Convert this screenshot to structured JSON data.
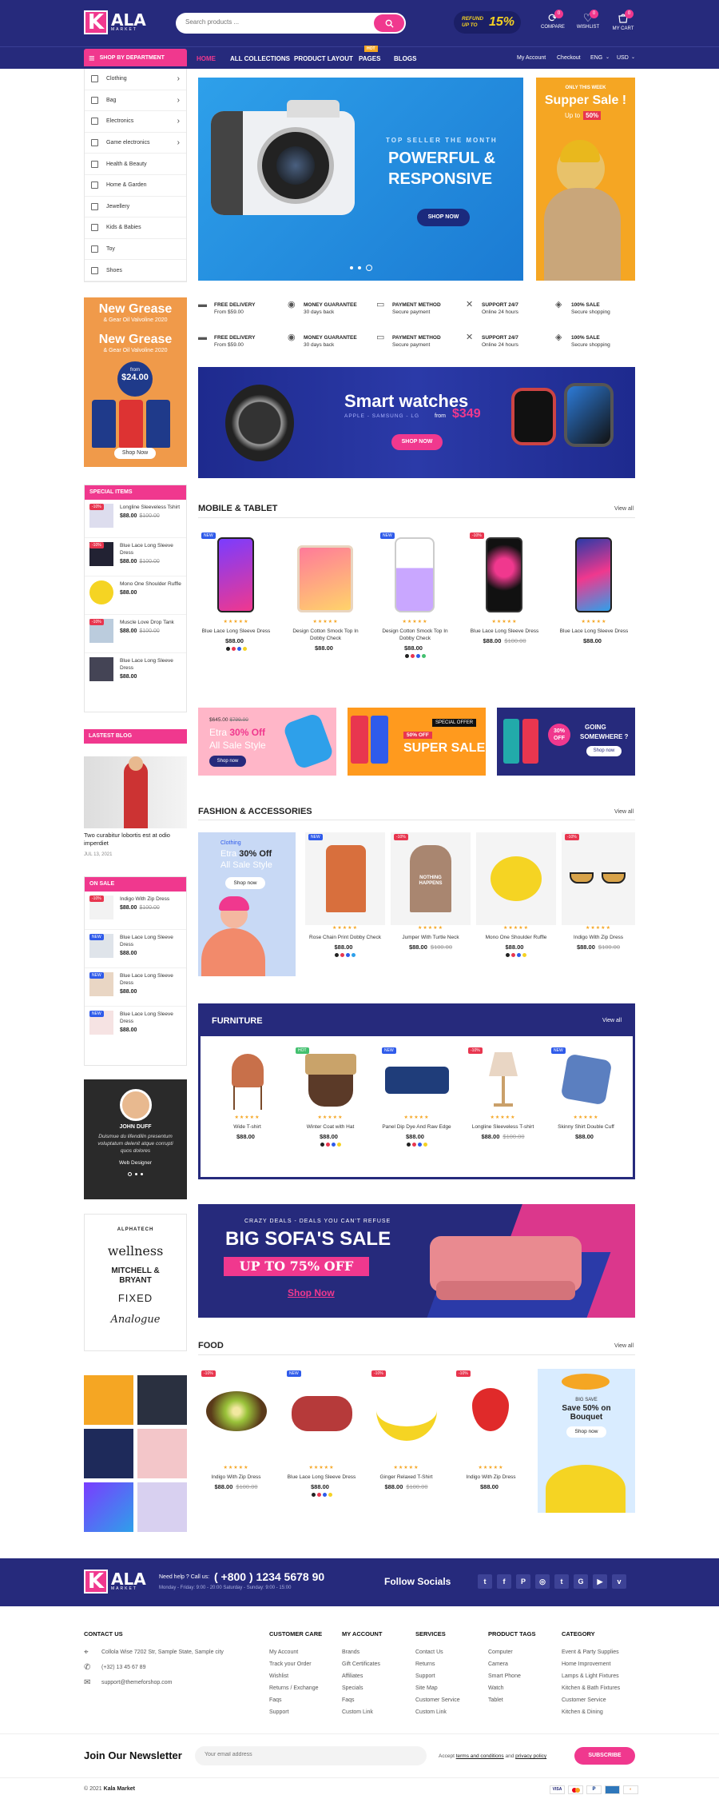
{
  "header": {
    "logo": "K",
    "logo_word": "ALA",
    "logo_sub": "MARKET",
    "search_placeholder": "Search products ...",
    "refund_line1": "REFUND",
    "refund_line2": "UP TO",
    "refund_pct": "15%",
    "compare_label": "COMPARE",
    "compare_count": "0",
    "wishlist_label": "WISHLIST",
    "wishlist_count": "0",
    "cart_label": "MY CART",
    "cart_count": "0"
  },
  "nav": {
    "shop_by": "SHOP BY DEPARTMENT",
    "items": [
      "HOME",
      "ALL COLLECTIONS",
      "PRODUCT LAYOUT",
      "PAGES",
      "BLOGS"
    ],
    "hot": "HOT",
    "right": [
      "My Account",
      "Checkout",
      "ENG",
      "USD"
    ]
  },
  "categories": [
    "Clothing",
    "Bag",
    "Electronics",
    "Game electronics",
    "Health & Beauty",
    "Home & Garden",
    "Jewellery",
    "Kids & Babies",
    "Toy",
    "Shoes"
  ],
  "hero": {
    "kicker": "TOP SELLER THE MONTH",
    "title1": "POWERFUL &",
    "title2": "RESPONSIVE",
    "cta": "SHOP NOW"
  },
  "promo_right": {
    "kicker": "ONLY THIS WEEK",
    "title": "Supper Sale !",
    "upto": "Up to",
    "pct": "50%"
  },
  "grease": {
    "l1": "New Grease",
    "l2": "& Gear Oil Valvoline 2020",
    "l3": "New Grease",
    "l4": "& Gear Oil Valvoline 2020",
    "from": "from",
    "price": "$24.00",
    "cta": "Shop Now"
  },
  "features": [
    {
      "t": "FREE DELIVERY",
      "s": "From $59.00"
    },
    {
      "t": "MONEY GUARANTEE",
      "s": "30 days back"
    },
    {
      "t": "PAYMENT METHOD",
      "s": "Secure payment"
    },
    {
      "t": "SUPPORT 24/7",
      "s": "Online 24 hours"
    },
    {
      "t": "100% SALE",
      "s": "Secure shopping"
    }
  ],
  "watch_banner": {
    "title": "Smart watches",
    "sub": "APPLE - SAMSUNG - LG",
    "from": "from",
    "price": "$349",
    "cta": "SHOP NOW"
  },
  "special": {
    "title": "SPECIAL ITEMS",
    "items": [
      {
        "n": "Longline Sleeveless Tshirt",
        "p": "$88.00",
        "o": "$100.00"
      },
      {
        "n": "Blue Lace Long Sleeve Dress",
        "p": "$88.00",
        "o": "$100.00"
      },
      {
        "n": "Mono One Shoulder Ruffle",
        "p": "$88.00",
        "o": ""
      },
      {
        "n": "Muscle Love Drop Tank",
        "p": "$88.00",
        "o": "$100.00"
      },
      {
        "n": "Blue Lace Long Sleeve Dress",
        "p": "$88.00",
        "o": ""
      }
    ]
  },
  "mobile": {
    "title": "MOBILE & TABLET",
    "viewall": "View all",
    "items": [
      {
        "n": "Blue Lace Long Sleeve Dress",
        "p": "$88.00",
        "o": ""
      },
      {
        "n": "Design Cotton Smock Top In Dobby Check",
        "p": "$88.00",
        "o": ""
      },
      {
        "n": "Design Cotton Smock Top In Dobby Check",
        "p": "$88.00",
        "o": ""
      },
      {
        "n": "Blue Lace Long Sleeve Dress",
        "p": "$88.00",
        "o": "$100.00"
      },
      {
        "n": "Blue Lace Long Sleeve Dress",
        "p": "$88.00",
        "o": ""
      }
    ]
  },
  "promo3": {
    "a_price": "$645.00",
    "a_old": "$799.00",
    "a_l1": "Etra",
    "a_pct": "30% Off",
    "a_l2": "All Sale Style",
    "a_cta": "Shop now",
    "b_l1": "50% OFF",
    "b_l2": "SUPER SALE",
    "b_tag": "SPECIAL OFFER",
    "c_pct": "30% OFF",
    "c_l1": "GOING",
    "c_l2": "SOMEWHERE ?",
    "c_cta": "Shop now"
  },
  "blog": {
    "title": "LASTEST BLOG",
    "post": "Two curabitur lobortis est at odio imperdiet",
    "date": "JUL 13, 2021"
  },
  "fashion": {
    "title": "FASHION & ACCESSORIES",
    "viewall": "View all",
    "promo_k": "Clothing",
    "promo_l1": "Etra",
    "promo_pct": "30% Off",
    "promo_l2": "All Sale Style",
    "promo_cta": "Shop now",
    "items": [
      {
        "n": "Rose Chain Print Dobby Check",
        "p": "$88.00",
        "o": ""
      },
      {
        "n": "Jumper With Turtle Neck",
        "p": "$88.00",
        "o": "$100.00"
      },
      {
        "n": "Mono One Shoulder Ruffle",
        "p": "$88.00",
        "o": ""
      },
      {
        "n": "Indigo With Zip Dress",
        "p": "$88.00",
        "o": "$100.00"
      }
    ],
    "hoodie_text": "NOTHING HAPPENS"
  },
  "onsale": {
    "title": "ON SALE",
    "items": [
      {
        "n": "Indigo With Zip Dress",
        "p": "$88.00",
        "o": "$100.00"
      },
      {
        "n": "Blue Lace Long Sleeve Dress",
        "p": "$88.00",
        "o": ""
      },
      {
        "n": "Blue Lace Long Sleeve Dress",
        "p": "$88.00",
        "o": ""
      },
      {
        "n": "Blue Lace Long Sleeve Dress",
        "p": "$88.00",
        "o": ""
      }
    ]
  },
  "furniture": {
    "title": "FURNITURE",
    "viewall": "View all",
    "items": [
      {
        "n": "Wide T-shirt",
        "p": "$88.00",
        "o": ""
      },
      {
        "n": "Winter Coat with Hat",
        "p": "$88.00",
        "o": ""
      },
      {
        "n": "Panel Dip Dye And Raw Edge",
        "p": "$88.00",
        "o": ""
      },
      {
        "n": "Longline Sleeveless T-shirt",
        "p": "$88.00",
        "o": "$100.00"
      },
      {
        "n": "Skinny Shirt Double Cuff",
        "p": "$88.00",
        "o": ""
      }
    ]
  },
  "testimonial": {
    "name": "JOHN DUFF",
    "quote": "Duismue du lifendilin presentum voluptatum delenit atque corrupti quos dolores",
    "role": "Web Designer"
  },
  "brands": [
    "ALPHATECH",
    "wellness",
    "MITCHELL & BRYANT",
    "FIXED",
    "Analogue"
  ],
  "sofa": {
    "kicker": "CRAZY DEALS - DEALS YOU CAN'T REFUSE",
    "title": "BIG SOFA'S SALE",
    "sub": "UP TO 75% OFF",
    "cta": "Shop Now"
  },
  "food": {
    "title": "FOOD",
    "viewall": "View all",
    "items": [
      {
        "n": "Indigo With Zip Dress",
        "p": "$88.00",
        "o": "$100.00"
      },
      {
        "n": "Blue Lace Long Sleeve Dress",
        "p": "$88.00",
        "o": ""
      },
      {
        "n": "Ginger Relaxed T-Shirt",
        "p": "$88.00",
        "o": "$100.00"
      },
      {
        "n": "Indigo With Zip Dress",
        "p": "$88.00",
        "o": ""
      }
    ],
    "promo_k": "BIG SAVE",
    "promo_l1": "Save 50% on",
    "promo_l2": "Bouquet",
    "promo_cta": "Shop now"
  },
  "footer_band": {
    "help": "Need help ? Call us:",
    "phone": "( +800 ) 1234 5678 90",
    "hours": "Monday - Friday: 9:00 - 20:00 Saturday - Sunday: 9:00 - 15:00",
    "follow": "Follow Socials"
  },
  "footer": {
    "contact_title": "CONTACT US",
    "address": "Collola Wise 7202 Str, Sample State, Sample city",
    "phone": "(+32) 13 45 67 89",
    "email": "support@themeforshop.com",
    "cols": [
      {
        "h": "CUSTOMER CARE",
        "l": [
          "My Account",
          "Track your Order",
          "Wishlist",
          "Returns / Exchange",
          "Faqs",
          "Support"
        ]
      },
      {
        "h": "MY ACCOUNT",
        "l": [
          "Brands",
          "Gift Certificates",
          "Affiliates",
          "Specials",
          "Faqs",
          "Custom Link"
        ]
      },
      {
        "h": "SERVICES",
        "l": [
          "Contact Us",
          "Returns",
          "Support",
          "Site Map",
          "Customer Service",
          "Custom Link"
        ]
      },
      {
        "h": "PRODUCT TAGS",
        "l": [
          "Computer",
          "Camera",
          "Smart Phone",
          "Watch",
          "Tablet"
        ]
      },
      {
        "h": "CATEGORY",
        "l": [
          "Event & Party Supplies",
          "Home Improvement",
          "Lamps & Light Fixtures",
          "Kitchen & Bath Fixtures",
          "Customer Service",
          "Kitchen & Dining"
        ]
      }
    ]
  },
  "newsletter": {
    "title": "Join Our Newsletter",
    "placeholder": "Your email address",
    "accept1": "Accept",
    "accept_link1": "terms and conditions",
    "accept2": "and",
    "accept_link2": "privacy policy",
    "cta": "SUBSCRIBE"
  },
  "copyright": {
    "pre": "© 2021",
    "brand": "Kala Market"
  },
  "colors": {
    "navy": "#262a7c",
    "pink": "#f0388e",
    "blue": "#1f8fe0",
    "orange": "#f5a623"
  }
}
